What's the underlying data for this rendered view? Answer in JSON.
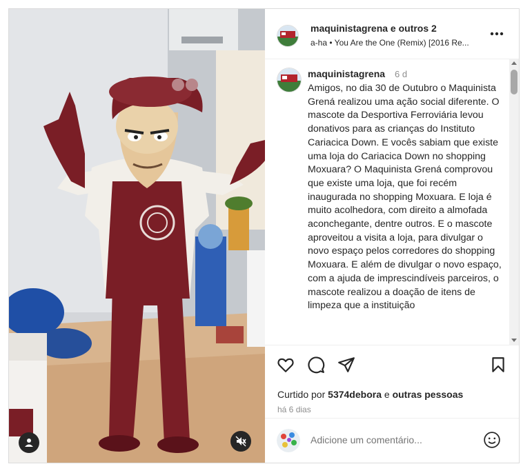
{
  "post": {
    "header": {
      "title": "maquinistagrena e outros 2",
      "music": "a-ha • You Are the One (Remix) [2016 Re..."
    },
    "caption": {
      "username": "maquinistagrena",
      "time": "6 d",
      "text": "Amigos, no dia 30 de Outubro o Maquinista Grená realizou uma ação social diferente. O mascote da Desportiva Ferroviária levou donativos para as crianças do Instituto Cariacica Down. E vocês sabiam que existe uma loja do Cariacica Down no shopping Moxuara? O Maquinista Grená comprovou que existe uma loja, que foi recém inaugurada no shopping Moxuara. E loja é muito acolhedora, com direito a almofada aconchegante, dentre outros. E o mascote aproveitou a visita a loja, para divulgar o novo espaço pelos corredores do shopping Moxuara. E além de divulgar o novo espaço, com a ajuda de imprescindíveis parceiros, o mascote realizou a doação de itens de limpeza que a instituição"
    },
    "likes": {
      "prefix": "Curtido por",
      "user": "5374debora",
      "middle": "e",
      "others": "outras pessoas"
    },
    "posted_ago": "há 6 dias",
    "comment": {
      "placeholder": "Adicione um comentário..."
    }
  },
  "icons": {
    "like": "heart-icon",
    "comment": "comment-icon",
    "share": "paper-plane-icon",
    "save": "bookmark-icon",
    "more": "more-horizontal-icon",
    "mute": "speaker-muted-icon",
    "tagged": "person-icon",
    "emoji": "emoji-icon"
  },
  "colors": {
    "mascot_maroon": "#7a1e26",
    "text": "#262626",
    "secondary": "#8e8e8e"
  }
}
